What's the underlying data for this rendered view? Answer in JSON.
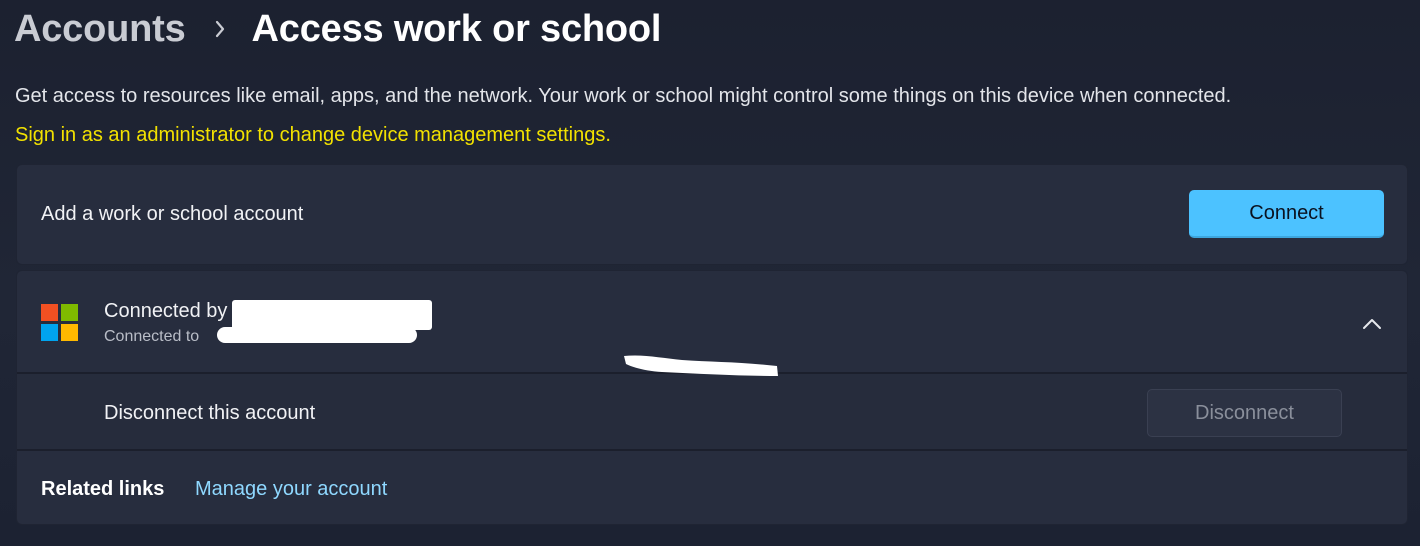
{
  "header": {
    "breadcrumb_parent": "Accounts",
    "breadcrumb_current": "Access work or school",
    "separator_icon": "chevron-right-icon"
  },
  "description": "Get access to resources like email, apps, and the network. Your work or school might control some things on this device when connected.",
  "admin_warning": "Sign in as an administrator to change device management settings.",
  "add_account": {
    "label": "Add a work or school account",
    "button_label": "Connect"
  },
  "connected_account": {
    "title_prefix": "Connected by",
    "subtitle_prefix": "Connected to",
    "logo_icon": "microsoft-logo-icon",
    "expand_icon": "chevron-up-icon",
    "disconnect_label": "Disconnect this account",
    "disconnect_button": "Disconnect"
  },
  "related_links": {
    "label": "Related links",
    "links": [
      "Manage your account"
    ]
  },
  "colors": {
    "accent": "#4cc2ff",
    "warning": "#f2e100",
    "link": "#8fd8ff",
    "ms_red": "#f25022",
    "ms_green": "#7fba00",
    "ms_blue": "#00a4ef",
    "ms_yellow": "#ffb900"
  }
}
